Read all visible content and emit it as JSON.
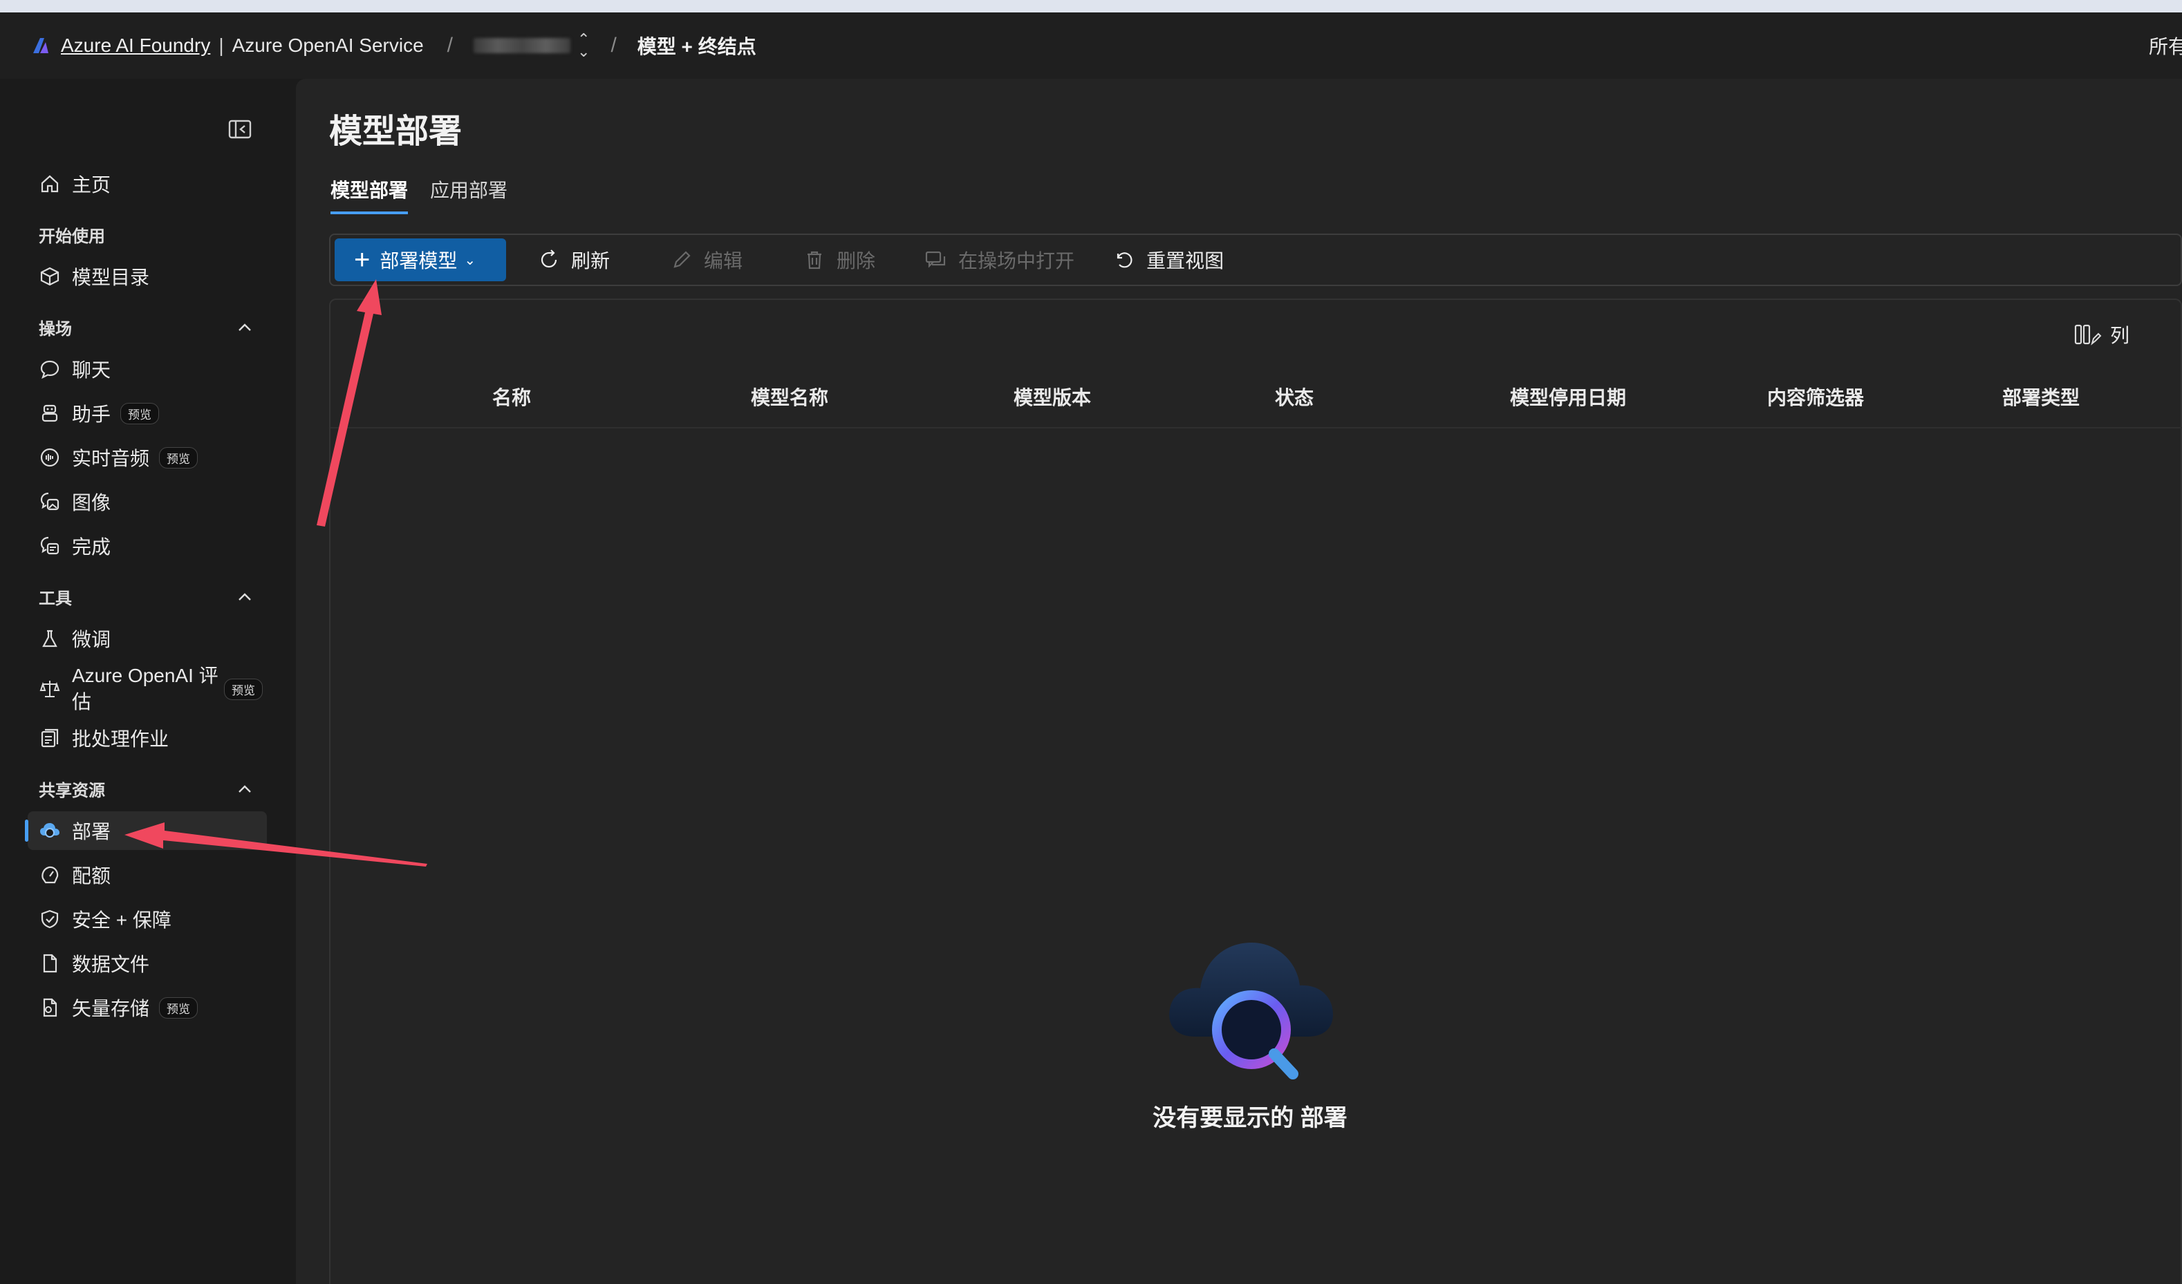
{
  "topbar": {
    "brand_link": "Azure AI Foundry",
    "separator": "|",
    "service": "Azure OpenAI Service",
    "slash1": "/",
    "slash2": "/",
    "crumb": "模型 + 终结点",
    "right_text": "所有"
  },
  "sidebar": {
    "home": "主页",
    "section_start": "开始使用",
    "model_catalog": "模型目录",
    "section_playground": "操场",
    "chat": "聊天",
    "assistants": "助手",
    "assistants_badge": "预览",
    "realtime_audio": "实时音频",
    "realtime_badge": "预览",
    "images": "图像",
    "completions": "完成",
    "section_tools": "工具",
    "fine_tuning": "微调",
    "evaluation_line1": "Azure OpenAI 评",
    "evaluation_line2": "估",
    "evaluation_badge": "预览",
    "batch_jobs": "批处理作业",
    "section_shared": "共享资源",
    "deployments": "部署",
    "quota": "配额",
    "safety": "安全 + 保障",
    "data_files": "数据文件",
    "vector_stores": "矢量存储",
    "vector_badge": "预览"
  },
  "main": {
    "title": "模型部署",
    "tabs": [
      {
        "label": "模型部署",
        "active": true
      },
      {
        "label": "应用部署",
        "active": false
      }
    ],
    "toolbar": {
      "deploy": "部署模型",
      "refresh": "刷新",
      "edit": "编辑",
      "delete": "删除",
      "open_playground": "在操场中打开",
      "reset_view": "重置视图"
    },
    "columns_button": "列",
    "columns": [
      "名称",
      "模型名称",
      "模型版本",
      "状态",
      "模型停用日期",
      "内容筛选器",
      "部署类型"
    ],
    "empty_message": "没有要显示的 部署"
  },
  "colors": {
    "accent": "#479ef5",
    "primary_button": "#115ea3",
    "annotation_arrow": "#f0485e"
  }
}
